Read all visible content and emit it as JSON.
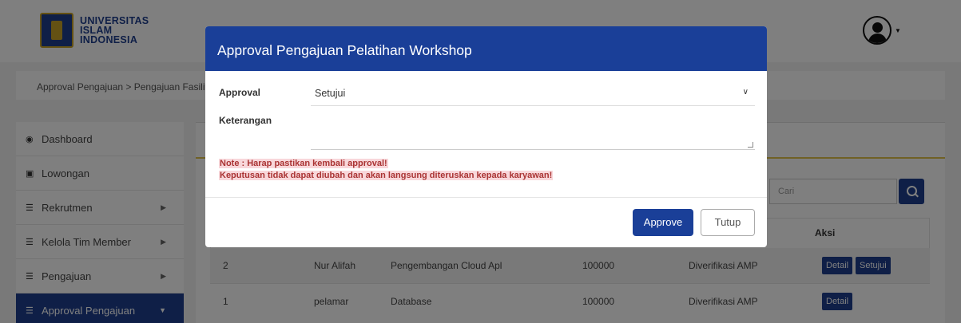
{
  "logo": {
    "line1": "UNIVERSITAS",
    "line2": "ISLAM",
    "line3": "INDONESIA"
  },
  "breadcrumb": {
    "text": "Approval Pengajuan  >  Pengajuan Fasilitas Pelatihan"
  },
  "sidebar": {
    "items": [
      {
        "label": "Dashboard",
        "icon": "dashboard-icon"
      },
      {
        "label": "Lowongan",
        "icon": "briefcase-icon"
      },
      {
        "label": "Rekrutmen",
        "icon": "list-icon"
      },
      {
        "label": "Kelola Tim Member",
        "icon": "list-icon"
      },
      {
        "label": "Pengajuan",
        "icon": "list-icon"
      },
      {
        "label": "Approval Pengajuan",
        "icon": "list-icon"
      }
    ]
  },
  "search": {
    "placeholder": "Cari"
  },
  "table": {
    "header_aksi": "Aksi",
    "rows": [
      {
        "no": "2",
        "nama": "Nur Alifah",
        "pelatihan": "Pengembangan Cloud Apl",
        "biaya": "100000",
        "status": "Diverifikasi AMP",
        "actions": [
          "Detail",
          "Setujui"
        ]
      },
      {
        "no": "1",
        "nama": "pelamar",
        "pelatihan": "Database",
        "biaya": "100000",
        "status": "Diverifikasi AMP",
        "actions": [
          "Detail"
        ]
      }
    ]
  },
  "modal": {
    "title": "Approval Pengajuan Pelatihan Workshop",
    "approval_label": "Approval",
    "approval_value": "Setujui",
    "keterangan_label": "Keterangan",
    "keterangan_value": "",
    "note_line1": "Note : Harap pastikan kembali approval!",
    "note_line2": "Keputusan tidak dapat diubah dan akan langsung diteruskan kepada karyawan!",
    "approve_label": "Approve",
    "tutup_label": "Tutup"
  },
  "colors": {
    "primary": "#1a3f98",
    "note_text": "#a33333",
    "note_bg": "#f8d7da"
  }
}
